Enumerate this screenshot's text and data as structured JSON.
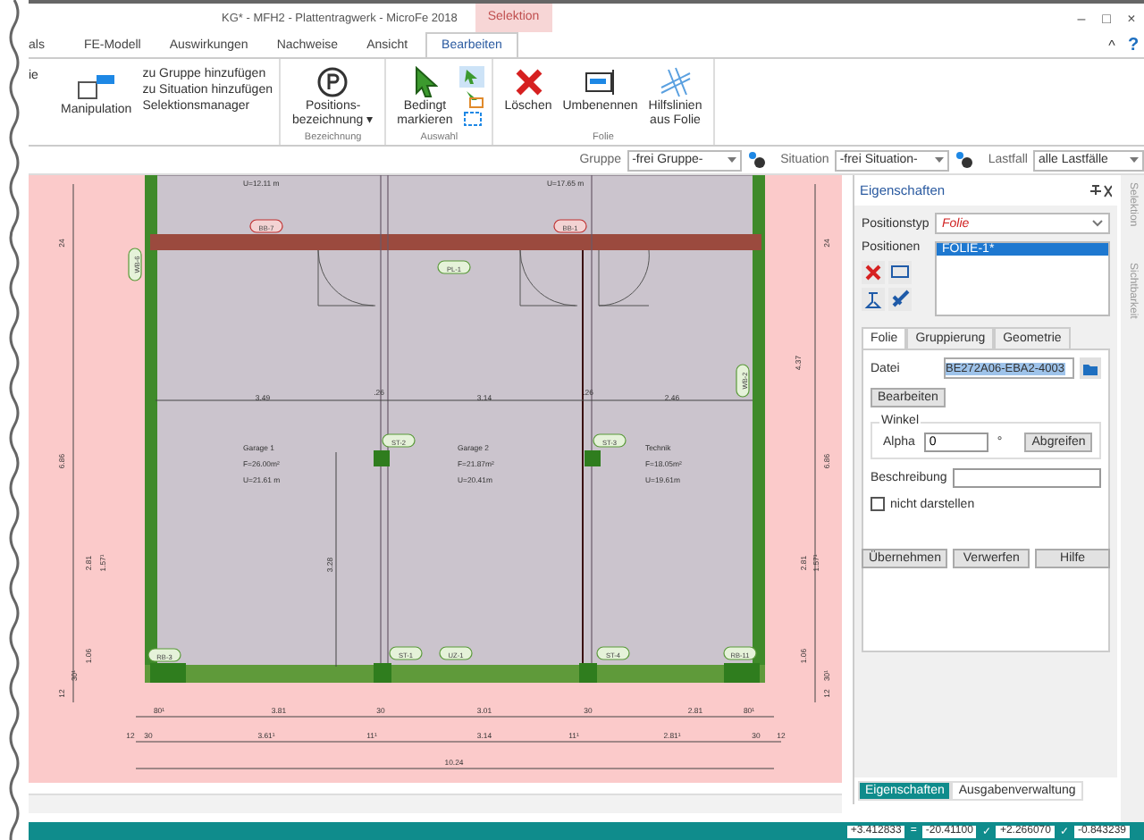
{
  "window": {
    "title": "KG* - MFH2 - Plattentragwerk - MicroFe 2018",
    "context_tab": "Selektion",
    "controls": [
      "–",
      "□",
      "×"
    ]
  },
  "ribbon_tabs": [
    {
      "label": "als",
      "selected": false
    },
    {
      "label": "FE-Modell",
      "selected": false
    },
    {
      "label": "Auswirkungen",
      "selected": false
    },
    {
      "label": "Nachweise",
      "selected": false
    },
    {
      "label": "Ansicht",
      "selected": false
    },
    {
      "label": "Bearbeiten",
      "selected": true
    }
  ],
  "ribbon_extra": {
    "collapse": "^",
    "help": "?"
  },
  "ribbon": {
    "cut_label": "ie",
    "manipulation": {
      "label": "Manipulation",
      "commands": [
        "zu Gruppe hinzufügen",
        "zu Situation hinzufügen",
        "Selektionsmanager"
      ]
    },
    "bezeichnung": {
      "group": "Bezeichnung",
      "lines": [
        "Positions-",
        "bezeichnung ▾"
      ]
    },
    "auswahl": {
      "group": "Auswahl",
      "lines": [
        "Bedingt",
        "markieren"
      ]
    },
    "folie": {
      "group": "Folie",
      "buttons": [
        {
          "kind": "delete",
          "lines": [
            "Löschen"
          ]
        },
        {
          "kind": "rename",
          "lines": [
            "Umbenennen"
          ]
        },
        {
          "kind": "guides",
          "lines": [
            "Hilfslinien",
            "aus Folie"
          ]
        }
      ]
    }
  },
  "filters": [
    {
      "label": "Gruppe",
      "value": "-frei Gruppe-"
    },
    {
      "label": "Situation",
      "value": "-frei Situation-"
    },
    {
      "label": "Lastfall",
      "value": "alle Lastfälle"
    }
  ],
  "drawing": {
    "perimeters_top": [
      "U=12.11 m",
      "U=17.65 m"
    ],
    "rooms": [
      {
        "name": "Garage 1",
        "area": "F=26.00m²",
        "perimeter": "U=21.61 m"
      },
      {
        "name": "Garage 2",
        "area": "F=21.87m²",
        "perimeter": "U=20.41m"
      },
      {
        "name": "Technik",
        "area": "F=18.05m²",
        "perimeter": "U=19.61m"
      }
    ],
    "tags": [
      "BB-7",
      "BB-1",
      "PL-1",
      "WB-6",
      "WB-2",
      "ST-2",
      "ST-3",
      "RB-3",
      "ST-1",
      "UZ-1",
      "ST-4",
      "RB-11"
    ],
    "inner_dims": [
      "3.49",
      ".26",
      "3.14",
      ".26",
      "2.46",
      "3.28"
    ],
    "dims_row_1": [
      "80¹",
      "3.81",
      "30",
      "3.01",
      "30",
      "2.81",
      "80¹"
    ],
    "dims_row_2": [
      "12",
      "30",
      "3.61¹",
      "11¹",
      "3.14",
      "11¹",
      "2.81¹",
      "30",
      "12"
    ],
    "total": "10.24",
    "left_dims": [
      "24",
      "6.86",
      "2.81",
      "1.57¹",
      "1.06",
      "30¹",
      "12"
    ],
    "right_dims": [
      "24",
      "4.37",
      "6.86",
      "2.81",
      "1.57¹",
      "1.06",
      "30¹",
      "12"
    ]
  },
  "properties": {
    "title": "Eigenschaften",
    "position_type": {
      "label": "Positionstyp",
      "value": "Folie"
    },
    "positions": {
      "label": "Positionen",
      "items": [
        {
          "label": "FOLIE-1*",
          "selected": true
        }
      ]
    },
    "tabs": [
      {
        "label": "Folie",
        "selected": true
      },
      {
        "label": "Gruppierung",
        "selected": false
      },
      {
        "label": "Geometrie",
        "selected": false
      }
    ],
    "file": {
      "label": "Datei",
      "value": "BE272A06-EBA2-4003",
      "edit_button": "Bearbeiten"
    },
    "angle": {
      "legend": "Winkel",
      "label": "Alpha",
      "value": "0",
      "unit": "°",
      "button": "Abgreifen"
    },
    "description": {
      "label": "Beschreibung"
    },
    "hide": {
      "label": "nicht darstellen",
      "checked": false
    },
    "buttons": [
      "Übernehmen",
      "Verwerfen",
      "Hilfe"
    ],
    "bottom_tabs": [
      {
        "label": "Eigenschaften",
        "selected": true
      },
      {
        "label": "Ausgabenverwaltung",
        "selected": false
      }
    ]
  },
  "side_tabs": [
    "Selektion",
    "Sichtbarkeit"
  ],
  "status_bar": {
    "values": [
      "+3.412833",
      "-20.41100",
      "+2.266070",
      "-0.843239"
    ],
    "separators": [
      "=",
      "✓",
      "✓"
    ]
  }
}
